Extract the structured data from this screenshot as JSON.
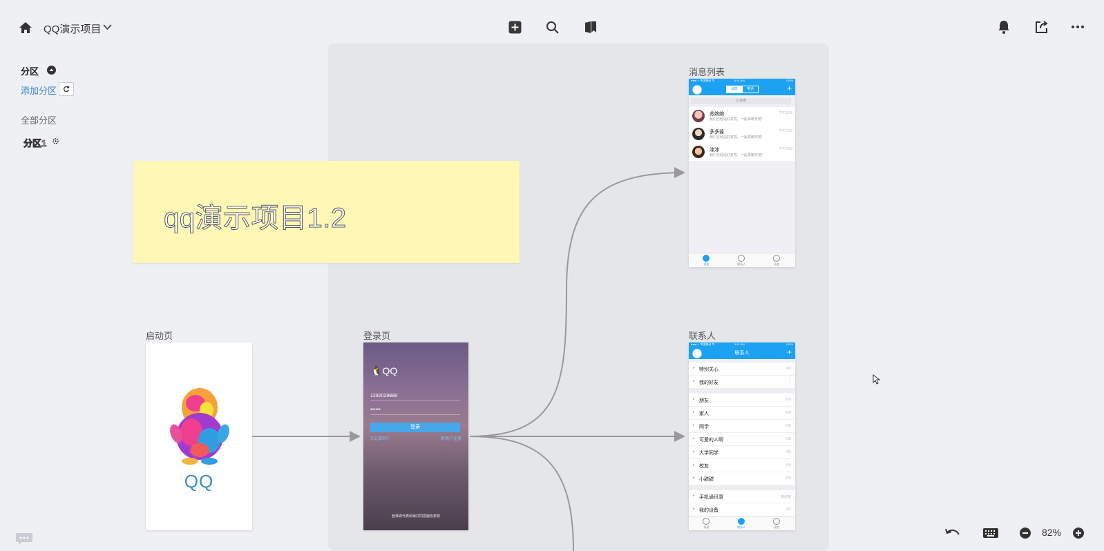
{
  "header": {
    "project_title": "QQ演示项目",
    "icons": [
      "home-icon",
      "chevron-down-icon",
      "add-square-icon",
      "search-icon",
      "bookmark-icon",
      "bell-icon",
      "share-icon",
      "more-icon"
    ]
  },
  "sidebar": {
    "section_title": "分区",
    "add_section": "添加分区",
    "all_sections": "全部分区",
    "items": [
      {
        "label": "分区1"
      }
    ]
  },
  "sticky": {
    "text": "qq演示项目1.2"
  },
  "screens": {
    "splash": {
      "label": "启动页",
      "logo_text": "QQ"
    },
    "login": {
      "label": "登录页",
      "brand": "QQ",
      "account": "1292029888",
      "password": "••••••",
      "button": "登录",
      "link_left": "忘记密码？",
      "link_right": "新用户注册",
      "footer": "登录即代表阅读并同意服务条款"
    },
    "messages": {
      "label": "消息列表",
      "status_left": "●●●○○ 中国移动 令",
      "status_mid": "9:41 AM",
      "status_right": "100%",
      "tabs": [
        "消息",
        "电话"
      ],
      "search_placeholder": "Q 搜索",
      "rows": [
        {
          "name": "苏婉婉",
          "preview": "我们已经是好友啦，一起来聊天吧!",
          "time": "下午3:29"
        },
        {
          "name": "多多酱",
          "preview": "我们已经是好友啦，一起来聊天吧!",
          "time": "下午3:29"
        },
        {
          "name": "漆漆",
          "preview": "我们已经是好友啦，一起来聊天吧!",
          "time": "下午3:29"
        }
      ],
      "tabbar": [
        "消息",
        "联系人",
        "动态"
      ]
    },
    "contacts": {
      "label": "联系人",
      "status_left": "●●●○○ 中国移动 令",
      "status_mid": "9:41 AM",
      "status_right": "100%",
      "title": "联系人",
      "group1": [
        {
          "name": "特别关心",
          "count": "0/0"
        },
        {
          "name": "我的好友",
          "count": "1"
        }
      ],
      "group2": [
        {
          "name": "朋友",
          "count": "0/0"
        },
        {
          "name": "家人",
          "count": "0/0"
        },
        {
          "name": "同学",
          "count": "0/0"
        },
        {
          "name": "可爱的人啊",
          "count": "0/0"
        },
        {
          "name": "大学同学",
          "count": "0/0"
        },
        {
          "name": "校友",
          "count": "0/0"
        },
        {
          "name": "小甜甜",
          "count": "0/0"
        }
      ],
      "group3": [
        {
          "name": "手机通讯录",
          "count": "未启用"
        },
        {
          "name": "我的设备",
          "count": "2/2"
        }
      ],
      "tabbar": [
        "消息",
        "联系人",
        "动态"
      ]
    }
  },
  "footer": {
    "zoom": "82%",
    "icons": [
      "undo-icon",
      "keyboard-icon",
      "zoom-out-icon",
      "zoom-in-icon",
      "chat-bubble-icon"
    ]
  },
  "colors": {
    "accent": "#1da1f2",
    "sticky": "#fff7b5",
    "canvas": "#e5e6ea",
    "link": "#3b7fd6"
  }
}
